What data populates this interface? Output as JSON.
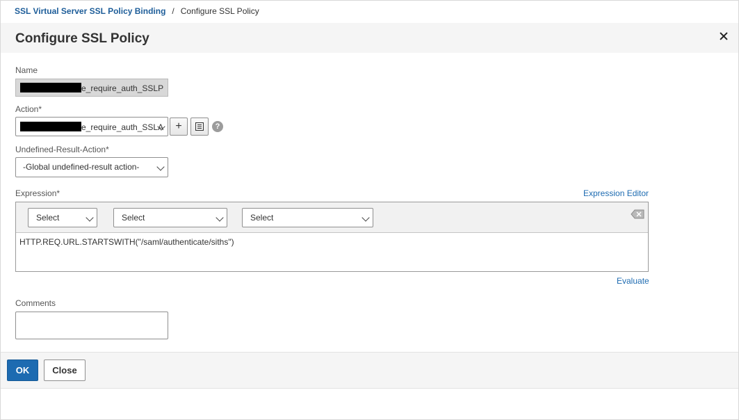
{
  "breadcrumb": {
    "parent": "SSL Virtual Server SSL Policy Binding",
    "separator": "/",
    "current": "Configure SSL Policy"
  },
  "dialog": {
    "title": "Configure SSL Policy",
    "close_icon": "close-icon"
  },
  "form": {
    "name": {
      "label": "Name",
      "value_suffix": "e_require_auth_SSLP"
    },
    "action": {
      "label": "Action*",
      "value_suffix": "e_require_auth_SSLA",
      "add_icon": "+",
      "edit_icon": "list-icon",
      "help_icon": "?"
    },
    "undefined_result_action": {
      "label": "Undefined-Result-Action*",
      "value": "-Global undefined-result action-"
    },
    "expression": {
      "label": "Expression*",
      "editor_link": "Expression Editor",
      "selects": [
        "Select",
        "Select",
        "Select"
      ],
      "value": "HTTP.REQ.URL.STARTSWITH(\"/saml/authenticate/siths\")",
      "evaluate_link": "Evaluate"
    },
    "comments": {
      "label": "Comments",
      "value": ""
    }
  },
  "footer": {
    "ok_label": "OK",
    "close_label": "Close"
  },
  "colors": {
    "accent": "#1d6bb1",
    "header_bg": "#f5f5f5"
  }
}
